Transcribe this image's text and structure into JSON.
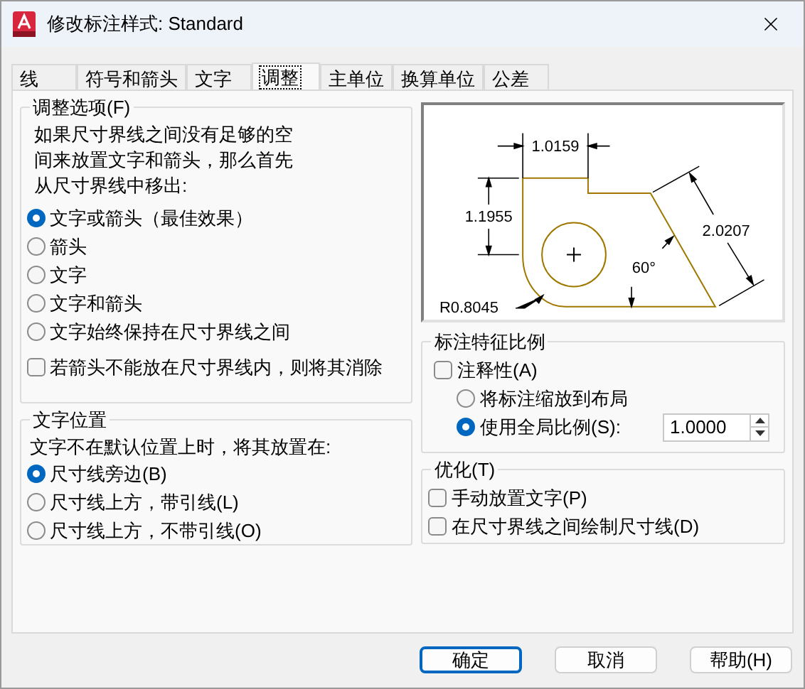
{
  "window": {
    "title": "修改标注样式: Standard"
  },
  "tabs": [
    {
      "label": "线",
      "selected": false
    },
    {
      "label": "符号和箭头",
      "selected": false
    },
    {
      "label": "文字",
      "selected": false
    },
    {
      "label": "调整",
      "selected": true
    },
    {
      "label": "主单位",
      "selected": false
    },
    {
      "label": "换算单位",
      "selected": false
    },
    {
      "label": "公差",
      "selected": false
    }
  ],
  "fit_options": {
    "title": "调整选项(F)",
    "description": "如果尺寸界线之间没有足够的空间来放置文字和箭头，那么首先从尺寸界线中移出:",
    "options": [
      {
        "label": "文字或箭头（最佳效果）",
        "selected": true
      },
      {
        "label": "箭头",
        "selected": false
      },
      {
        "label": "文字",
        "selected": false
      },
      {
        "label": "文字和箭头",
        "selected": false
      },
      {
        "label": "文字始终保持在尺寸界线之间",
        "selected": false
      }
    ],
    "suppress": {
      "label": "若箭头不能放在尺寸界线内，则将其消除",
      "checked": false
    }
  },
  "text_placement": {
    "title": "文字位置",
    "description": "文字不在默认位置上时，将其放置在:",
    "options": [
      {
        "label": "尺寸线旁边(B)",
        "selected": true
      },
      {
        "label": "尺寸线上方，带引线(L)",
        "selected": false
      },
      {
        "label": "尺寸线上方，不带引线(O)",
        "selected": false
      }
    ]
  },
  "preview": {
    "labels": [
      "1.0159",
      "1.1955",
      "2.0207",
      "60°",
      "R0.8045"
    ]
  },
  "scale": {
    "title": "标注特征比例",
    "annotative": {
      "label": "注释性(A)",
      "checked": false
    },
    "options": [
      {
        "label": "将标注缩放到布局",
        "selected": false
      },
      {
        "label": "使用全局比例(S):",
        "selected": true
      }
    ],
    "value": "1.0000"
  },
  "fine_tuning": {
    "title": "优化(T)",
    "options": [
      {
        "label": "手动放置文字(P)",
        "checked": false
      },
      {
        "label": "在尺寸界线之间绘制尺寸线(D)",
        "checked": false
      }
    ]
  },
  "buttons": [
    {
      "label": "确定",
      "default": true
    },
    {
      "label": "取消",
      "default": false
    },
    {
      "label": "帮助(H)",
      "default": false
    }
  ]
}
